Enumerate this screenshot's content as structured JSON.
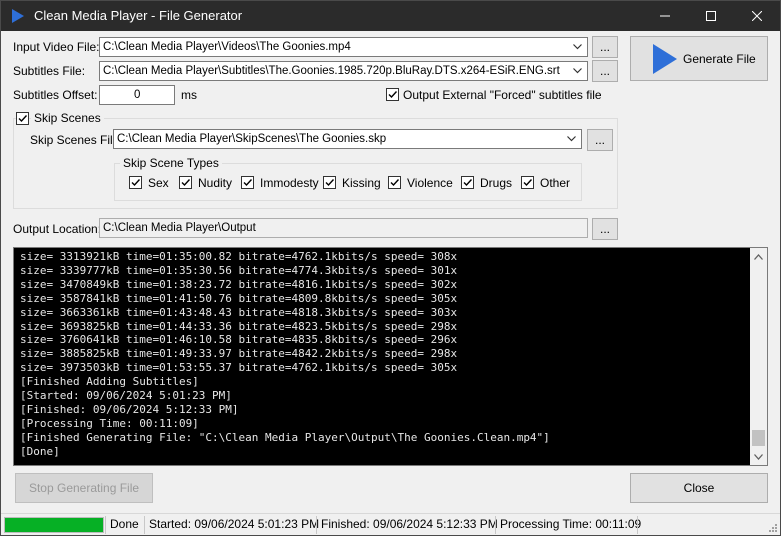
{
  "window": {
    "title": "Clean Media Player - File Generator"
  },
  "form": {
    "input_video_label": "Input Video File:",
    "input_video_value": "C:\\Clean Media Player\\Videos\\The Goonies.mp4",
    "subtitles_label": "Subtitles File:",
    "subtitles_value": "C:\\Clean Media Player\\Subtitles\\The.Goonies.1985.720p.BluRay.DTS.x264-ESiR.ENG.srt",
    "offset_label": "Subtitles Offset:",
    "offset_value": "0",
    "offset_unit": "ms",
    "forced_label": "Output External \"Forced\" subtitles file",
    "forced_checked": true,
    "skip_scenes_label": "Skip Scenes",
    "skip_scenes_checked": true,
    "skip_file_label": "Skip Scenes File:",
    "skip_file_value": "C:\\Clean Media Player\\SkipScenes\\The Goonies.skp",
    "skip_types_label": "Skip Scene Types",
    "skip_types": [
      {
        "label": "Sex",
        "checked": true
      },
      {
        "label": "Nudity",
        "checked": true
      },
      {
        "label": "Immodesty",
        "checked": true
      },
      {
        "label": "Kissing",
        "checked": true
      },
      {
        "label": "Violence",
        "checked": true
      },
      {
        "label": "Drugs",
        "checked": true
      },
      {
        "label": "Other",
        "checked": true
      }
    ],
    "output_label": "Output Location:",
    "output_value": "C:\\Clean Media Player\\Output",
    "browse_label": "...",
    "generate_label": "Generate File"
  },
  "console": {
    "lines": [
      "size= 3313921kB time=01:35:00.82 bitrate=4762.1kbits/s speed= 308x",
      "size= 3339777kB time=01:35:30.56 bitrate=4774.3kbits/s speed= 301x",
      "size= 3470849kB time=01:38:23.72 bitrate=4816.1kbits/s speed= 302x",
      "size= 3587841kB time=01:41:50.76 bitrate=4809.8kbits/s speed= 305x",
      "size= 3663361kB time=01:43:48.43 bitrate=4818.3kbits/s speed= 303x",
      "size= 3693825kB time=01:44:33.36 bitrate=4823.5kbits/s speed= 298x",
      "size= 3760641kB time=01:46:10.58 bitrate=4835.8kbits/s speed= 296x",
      "size= 3885825kB time=01:49:33.97 bitrate=4842.2kbits/s speed= 298x",
      "size= 3973503kB time=01:53:55.37 bitrate=4762.1kbits/s speed= 305x",
      "[Finished Adding Subtitles]",
      "[Started: 09/06/2024 5:01:23 PM]",
      "[Finished: 09/06/2024 5:12:33 PM]",
      "[Processing Time: 00:11:09]",
      "[Finished Generating File: \"C:\\Clean Media Player\\Output\\The Goonies.Clean.mp4\"]",
      "[Done]"
    ]
  },
  "buttons": {
    "stop_label": "Stop Generating File",
    "close_label": "Close"
  },
  "status": {
    "progress_percent": 100,
    "progress_color": "#06b025",
    "state": "Done",
    "started": "Started: 09/06/2024 5:01:23 PM",
    "finished": "Finished: 09/06/2024 5:12:33 PM",
    "processing": "Processing Time: 00:11:09"
  },
  "colors": {
    "accent_blue": "#2e6fd8",
    "console_bg": "#000000",
    "titlebar_bg": "#2b2b2b"
  }
}
